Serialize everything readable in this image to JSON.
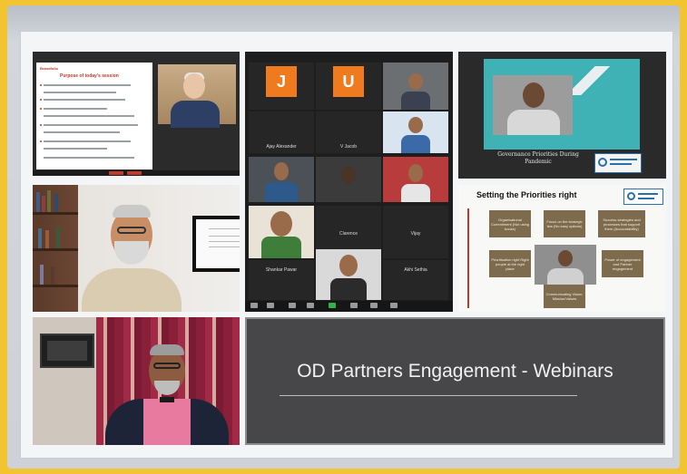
{
  "banner": {
    "title": "OD Partners Engagement - Webinars"
  },
  "slide_purpose": {
    "brand": "Brandfolio",
    "title": "Purpose of today's session"
  },
  "gallery": {
    "participants": [
      {
        "initial": "J",
        "name": "Ajay Alexander",
        "color": "#f07a1e"
      },
      {
        "initial": "U",
        "name": "V Jacob",
        "color": "#f07a1e"
      },
      {
        "name": "Shankar Pawar"
      },
      {
        "name": "Clarence"
      },
      {
        "name": "Vijay"
      },
      {
        "name": "Akhi Sethia"
      }
    ]
  },
  "governance_slide": {
    "title": "Governance Priorities During Pandemic"
  },
  "priorities_slide": {
    "title": "Setting the Priorities right",
    "boxes": [
      "Organisational Commitment (Not using books)",
      "Focus on the strategic few (No easy options)",
      "Success strategies and processes that support them (Accountability)",
      "Prioritisation right Right people at the right place",
      "Power of engagement and Partner engagement",
      "Communicating Vision, Mission/Values"
    ]
  },
  "colors": {
    "background": "#f2c431",
    "zoom_green": "#2fb34a",
    "avatar_orange": "#f07a1e"
  }
}
